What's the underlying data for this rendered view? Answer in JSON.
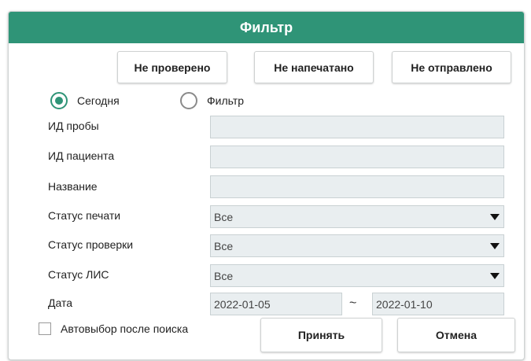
{
  "dialog": {
    "title": "Фильтр"
  },
  "quick_filters": {
    "unchecked": "Не проверено",
    "unprinted": "Не напечатано",
    "unsent": "Не отправлено"
  },
  "mode": {
    "today_label": "Сегодня",
    "filter_label": "Фильтр",
    "selected": "today"
  },
  "fields": {
    "sample_id_label": "ИД пробы",
    "sample_id_value": "",
    "patient_id_label": "ИД пациента",
    "patient_id_value": "",
    "name_label": "Название",
    "name_value": "",
    "print_status_label": "Статус печати",
    "print_status_value": "Все",
    "check_status_label": "Статус проверки",
    "check_status_value": "Все",
    "lis_status_label": "Статус ЛИС",
    "lis_status_value": "Все",
    "date_label": "Дата",
    "date_from": "2022-01-05",
    "date_separator": "~",
    "date_to": "2022-01-10"
  },
  "footer": {
    "autoselect_label": "Автовыбор после поиска",
    "autoselect_checked": false,
    "accept_label": "Принять",
    "cancel_label": "Отмена"
  },
  "colors": {
    "header": "#2f9477",
    "field_bg": "#e9eef0"
  }
}
